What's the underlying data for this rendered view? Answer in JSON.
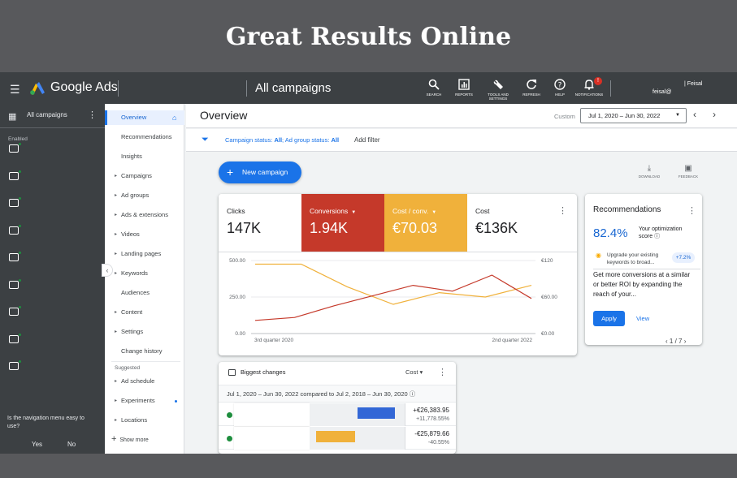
{
  "banner": {
    "title": "Great Results Online"
  },
  "header": {
    "brand": "Google Ads",
    "breadcrumb": "All campaigns",
    "tools": [
      {
        "label": "SEARCH",
        "icon": "search-icon"
      },
      {
        "label": "REPORTS",
        "icon": "reports-icon"
      },
      {
        "label": "TOOLS AND SETTINGS",
        "icon": "wrench-icon"
      },
      {
        "label": "REFRESH",
        "icon": "refresh-icon"
      },
      {
        "label": "HELP",
        "icon": "help-icon"
      },
      {
        "label": "NOTIFICATIONS",
        "icon": "bell-icon"
      }
    ],
    "notifications_count": "!",
    "account_line1": "| Feisal",
    "account_line2": "feisal@"
  },
  "leftnav": {
    "title": "All campaigns",
    "section_label": "Enabled",
    "survey_question": "Is the navigation menu easy to use?",
    "yes": "Yes",
    "no": "No"
  },
  "subnav": {
    "items": [
      {
        "label": "Overview",
        "active": true
      },
      {
        "label": "Recommendations"
      },
      {
        "label": "Insights"
      },
      {
        "label": "Campaigns",
        "arrow": true
      },
      {
        "label": "Ad groups",
        "arrow": true
      },
      {
        "label": "Ads & extensions",
        "arrow": true
      },
      {
        "label": "Videos",
        "arrow": true
      },
      {
        "label": "Landing pages",
        "arrow": true
      },
      {
        "label": "Keywords",
        "arrow": true
      },
      {
        "label": "Audiences"
      },
      {
        "label": "Content",
        "arrow": true
      },
      {
        "label": "Settings",
        "arrow": true
      },
      {
        "label": "Change history"
      }
    ],
    "suggested_label": "Suggested",
    "suggested": [
      {
        "label": "Ad schedule",
        "arrow": true
      },
      {
        "label": "Experiments",
        "arrow": true,
        "dot": true
      },
      {
        "label": "Locations",
        "arrow": true
      }
    ],
    "show_more": "Show more"
  },
  "overview": {
    "title": "Overview",
    "custom_label": "Custom",
    "date_range": "Jul 1, 2020 – Jun 30, 2022",
    "filter_text_prefix": "Campaign status: ",
    "filter_campaign_value": "All",
    "filter_mid": "; Ad group status: ",
    "filter_adgroup_value": "All",
    "add_filter": "Add filter",
    "new_campaign": "New campaign",
    "download": "DOWNLOAD",
    "feedback": "FEEDBACK"
  },
  "metrics": [
    {
      "label": "Clicks",
      "value": "147K",
      "bg": "#ffffff",
      "fg": "#202124"
    },
    {
      "label": "Conversions",
      "value": "1.94K",
      "bg": "#c5392a",
      "fg": "#ffffff",
      "dropdown": true
    },
    {
      "label": "Cost / conv.",
      "value": "€70.03",
      "bg": "#f0b13b",
      "fg": "#ffffff",
      "dropdown": true
    },
    {
      "label": "Cost",
      "value": "€136K",
      "bg": "#ffffff",
      "fg": "#202124"
    }
  ],
  "chart_data": {
    "type": "line",
    "x_labels": [
      "3rd quarter 2020",
      "2nd quarter 2022"
    ],
    "y_left_ticks": [
      "500.00",
      "250.00",
      "0.00"
    ],
    "y_right_ticks": [
      "€120",
      "€60.00",
      "€0.00"
    ],
    "ylim_left": [
      0,
      500
    ],
    "series": [
      {
        "color": "#f0b13b",
        "values": [
          475,
          475,
          320,
          200,
          280,
          250,
          330
        ]
      },
      {
        "color": "#c5392a",
        "values": [
          90,
          110,
          190,
          260,
          330,
          290,
          400,
          240
        ]
      }
    ]
  },
  "recommendations": {
    "title": "Recommendations",
    "score": "82.4%",
    "score_label": "Your optimization score",
    "tip": "Upgrade your existing keywords to broad...",
    "tip_pct": "+7.2%",
    "body": "Get more conversions at a similar or better ROI by expanding the reach of your...",
    "apply": "Apply",
    "view": "View",
    "pager": "1 / 7"
  },
  "biggest_changes": {
    "title": "Biggest changes",
    "metric": "Cost",
    "dates": "Jul 1, 2020 – Jun 30, 2022 compared to Jul 2, 2018 – Jun 30, 2020",
    "rows": [
      {
        "value": "+€26,383.95",
        "pct": "+11,778.55%",
        "bar_color": "#3367d6",
        "bar_start": 0.5,
        "bar_frac": 0.4
      },
      {
        "value": "-€25,879.66",
        "pct": "-40.55%",
        "bar_color": "#f0b13b",
        "bar_start": 0.07,
        "bar_frac": 0.41
      }
    ]
  }
}
